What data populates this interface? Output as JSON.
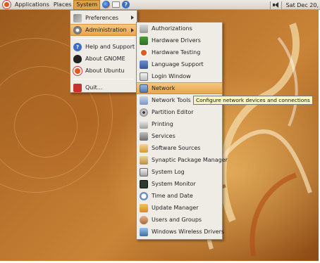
{
  "top_panel": {
    "menus": [
      "Applications",
      "Places",
      "System"
    ],
    "clock": "Sat Dec 20,",
    "launchers": [
      "firefox-icon",
      "mail-icon",
      "help-icon"
    ]
  },
  "system_menu": {
    "items": [
      {
        "label": "Preferences",
        "icon": "preferences-icon",
        "submenu": true
      },
      {
        "label": "Administration",
        "icon": "administration-icon",
        "submenu": true,
        "active": true
      },
      {
        "label": "Help and Support",
        "icon": "help-icon"
      },
      {
        "label": "About GNOME",
        "icon": "gnome-foot-icon"
      },
      {
        "label": "About Ubuntu",
        "icon": "ubuntu-logo-icon"
      },
      {
        "label": "Quit...",
        "icon": "power-icon"
      }
    ]
  },
  "admin_menu": {
    "items": [
      {
        "label": "Authorizations",
        "icon": "authorizations-icon"
      },
      {
        "label": "Hardware Drivers",
        "icon": "hardware-drivers-icon"
      },
      {
        "label": "Hardware Testing",
        "icon": "hardware-testing-icon"
      },
      {
        "label": "Language Support",
        "icon": "language-support-icon"
      },
      {
        "label": "Login Window",
        "icon": "login-window-icon"
      },
      {
        "label": "Network",
        "icon": "network-icon",
        "highlighted": true
      },
      {
        "label": "Network Tools",
        "icon": "network-tools-icon"
      },
      {
        "label": "Partition Editor",
        "icon": "partition-editor-icon"
      },
      {
        "label": "Printing",
        "icon": "printer-icon"
      },
      {
        "label": "Services",
        "icon": "services-icon"
      },
      {
        "label": "Software Sources",
        "icon": "software-sources-icon"
      },
      {
        "label": "Synaptic Package Manager",
        "icon": "synaptic-icon"
      },
      {
        "label": "System Log",
        "icon": "system-log-icon"
      },
      {
        "label": "System Monitor",
        "icon": "system-monitor-icon"
      },
      {
        "label": "Time and Date",
        "icon": "time-date-icon"
      },
      {
        "label": "Update Manager",
        "icon": "update-manager-icon"
      },
      {
        "label": "Users and Groups",
        "icon": "users-groups-icon"
      },
      {
        "label": "Windows Wireless Drivers",
        "icon": "wireless-drivers-icon"
      }
    ]
  },
  "tooltip": {
    "text": "Configure network devices and connections"
  },
  "colors": {
    "highlight": "#e9a64b",
    "menu_bg": "#efece6",
    "panel_bg": "#dcd7ce",
    "tooltip_bg": "#f9f7bf",
    "wallpaper": "#b9722c"
  }
}
